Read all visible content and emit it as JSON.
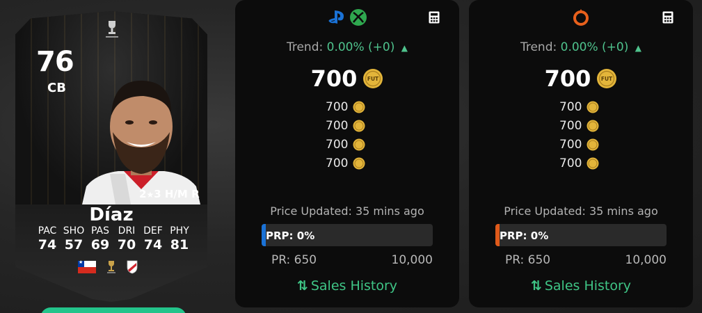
{
  "player": {
    "rating": "76",
    "position": "CB",
    "name": "Díaz",
    "attributes": {
      "skills": "2",
      "weak_foot": "3",
      "work_rate": "H/M",
      "foot": "R"
    },
    "stats": [
      {
        "label": "PAC",
        "value": "74"
      },
      {
        "label": "SHO",
        "value": "57"
      },
      {
        "label": "PAS",
        "value": "69"
      },
      {
        "label": "DRI",
        "value": "70"
      },
      {
        "label": "DEF",
        "value": "74"
      },
      {
        "label": "PHY",
        "value": "81"
      }
    ],
    "badges": {
      "nation": "chile-flag",
      "league": "league-trophy-icon",
      "club": "club-crest"
    }
  },
  "panels": [
    {
      "platform_icons": [
        "playstation-icon",
        "xbox-icon"
      ],
      "trend_label": "Trend:",
      "trend_value": "0.00% (+0)",
      "main_price": "700",
      "prices": [
        "700",
        "700",
        "700",
        "700"
      ],
      "updated": "Price Updated: 35 mins ago",
      "prp": "PRP: 0%",
      "pr_min": "PR: 650",
      "pr_max": "10,000",
      "sales_history": "Sales History",
      "accent_color": "#1a72d6"
    },
    {
      "platform_icons": [
        "origin-icon"
      ],
      "trend_label": "Trend:",
      "trend_value": "0.00% (+0)",
      "main_price": "700",
      "prices": [
        "700",
        "700",
        "700",
        "700"
      ],
      "updated": "Price Updated: 35 mins ago",
      "prp": "PRP: 0%",
      "pr_min": "PR: 650",
      "pr_max": "10,000",
      "sales_history": "Sales History",
      "accent_color": "#e05a1a"
    }
  ],
  "coin_label": "FUT",
  "colors": {
    "trend_green": "#4fc38d",
    "link_green": "#3fc586",
    "panel_bg": "#0c0c0c",
    "coin_gold": "#e3b53a"
  }
}
